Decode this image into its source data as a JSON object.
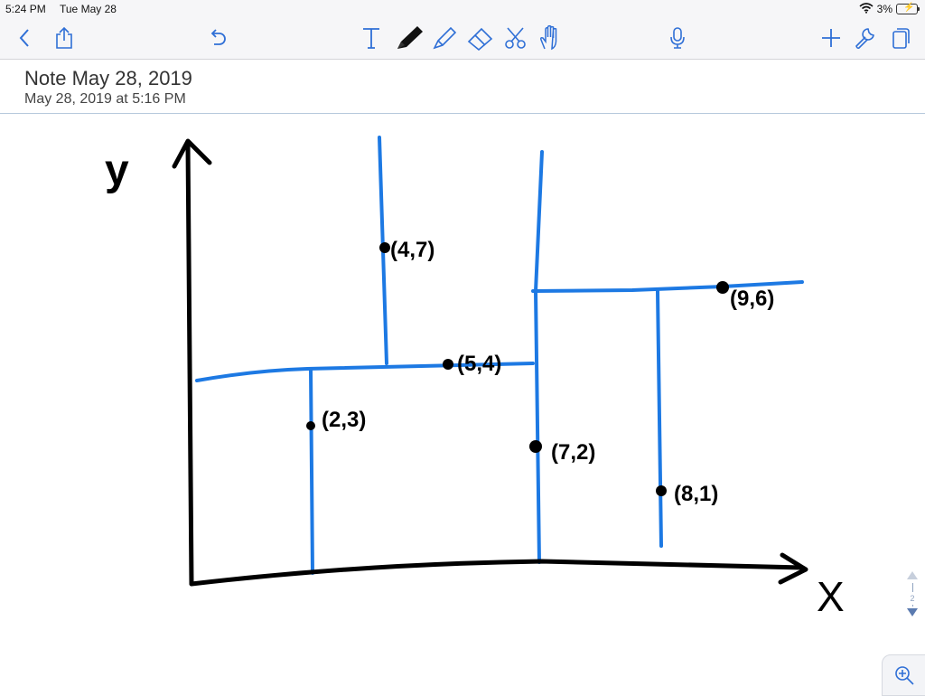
{
  "status_bar": {
    "time": "5:24 PM",
    "date": "Tue May 28",
    "battery": "3%"
  },
  "toolbar": {
    "icons": [
      "chevron-left-icon",
      "share-icon",
      "undo-icon",
      "text-icon",
      "pen-icon",
      "highlighter-icon",
      "eraser-icon",
      "scissors-icon",
      "hand-icon",
      "microphone-icon",
      "plus-icon",
      "wrench-icon",
      "pages-icon"
    ],
    "accent_color": "#2f6fd6"
  },
  "note": {
    "title": "Note May 28, 2019",
    "subtitle": "May 28, 2019 at 5:16 PM"
  },
  "drawing": {
    "axis_labels": {
      "x": "X",
      "y": "y"
    },
    "points": [
      {
        "label": "(2,3)"
      },
      {
        "label": "(4,7)"
      },
      {
        "label": "(5,4)"
      },
      {
        "label": "(7,2)"
      },
      {
        "label": "(8,1)"
      },
      {
        "label": "(9,6)"
      }
    ],
    "ink_color": "#000000",
    "line_color": "#1d79e3"
  },
  "pager": {
    "current": "1",
    "total": "2"
  }
}
